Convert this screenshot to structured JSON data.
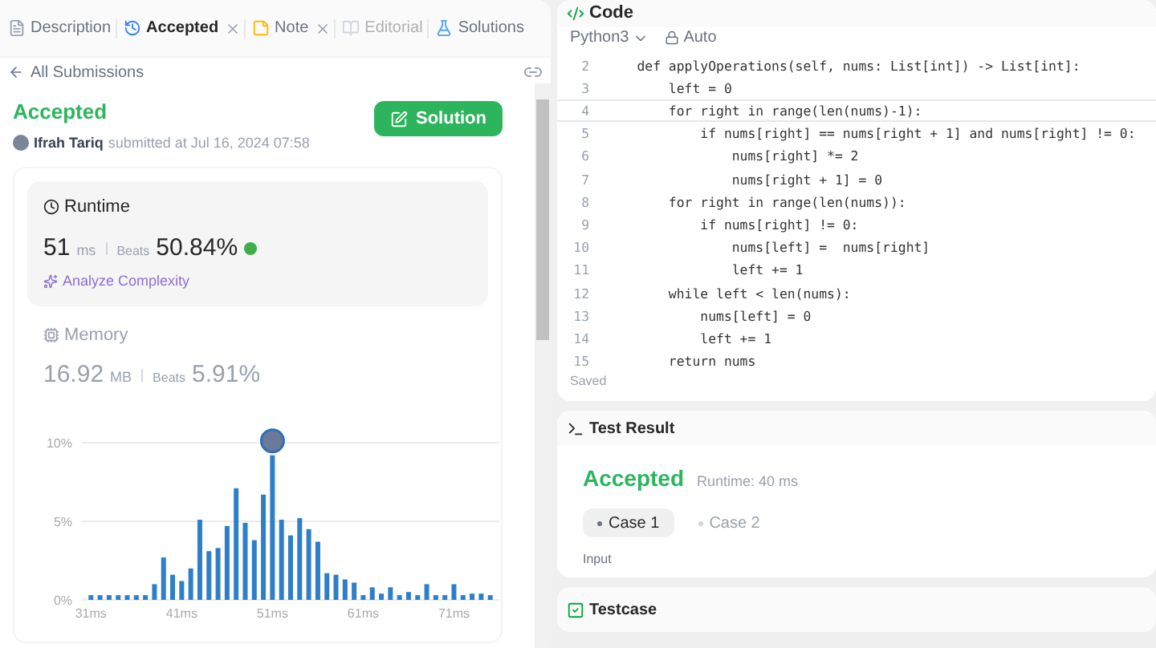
{
  "left_tabs": [
    {
      "label": "Description",
      "selected": false,
      "closable": false,
      "disabled": false,
      "kind": "doc"
    },
    {
      "label": "Accepted",
      "selected": true,
      "closable": true,
      "disabled": false,
      "kind": "history"
    },
    {
      "label": "Note",
      "selected": false,
      "closable": true,
      "disabled": false,
      "kind": "note"
    },
    {
      "label": "Editorial",
      "selected": false,
      "closable": false,
      "disabled": true,
      "kind": "book"
    },
    {
      "label": "Solutions",
      "selected": false,
      "closable": false,
      "disabled": false,
      "kind": "flask"
    }
  ],
  "back_link": "All Submissions",
  "submission": {
    "status": "Accepted",
    "author": "Ifrah Tariq",
    "submitted": "submitted at Jul 16, 2024 07:58",
    "solution_button": "Solution"
  },
  "metrics": [
    {
      "title": "Runtime",
      "value": "51",
      "unit": "ms",
      "beats_label": "Beats",
      "beats": "50.84%",
      "selected": true,
      "analyze": "Analyze Complexity",
      "kind": "clock"
    },
    {
      "title": "Memory",
      "value": "16.92",
      "unit": "MB",
      "beats_label": "Beats",
      "beats": "5.91%",
      "selected": false,
      "kind": "chip"
    }
  ],
  "chart_data": {
    "type": "bar",
    "x": [
      31,
      32,
      33,
      34,
      35,
      36,
      37,
      38,
      39,
      40,
      41,
      42,
      43,
      44,
      45,
      46,
      47,
      48,
      49,
      50,
      51,
      52,
      53,
      54,
      55,
      56,
      57,
      58,
      59,
      60,
      61,
      62,
      63,
      64,
      65,
      66,
      67,
      68,
      69,
      70,
      71,
      72,
      73,
      74,
      75
    ],
    "values": [
      0.3,
      0.3,
      0.3,
      0.3,
      0.3,
      0.3,
      0.3,
      1.0,
      2.7,
      1.6,
      1.2,
      2.0,
      5.1,
      3.1,
      3.3,
      4.7,
      7.1,
      4.9,
      3.8,
      6.7,
      9.2,
      5.1,
      4.1,
      5.2,
      4.5,
      3.7,
      1.7,
      1.6,
      1.3,
      1.1,
      0.3,
      0.8,
      0.4,
      0.8,
      0.3,
      0.5,
      0.3,
      1.0,
      0.3,
      0.3,
      1.0,
      0.3,
      0.4,
      0.4,
      0.3
    ],
    "ylim": [
      0,
      10
    ],
    "yticks": [
      {
        "value": 0,
        "label": "0%"
      },
      {
        "value": 5,
        "label": "5%"
      },
      {
        "value": 10,
        "label": "10%"
      }
    ],
    "xticks": [
      {
        "value": 31,
        "label": "31ms"
      },
      {
        "value": 41,
        "label": "41ms"
      },
      {
        "value": 51,
        "label": "51ms"
      },
      {
        "value": 61,
        "label": "61ms"
      },
      {
        "value": 71,
        "label": "71ms"
      }
    ],
    "xlim": [
      30,
      76
    ]
  },
  "code_panel": {
    "title": "Code",
    "language": "Python3",
    "mode": "Auto",
    "status": "Saved",
    "lines": [
      {
        "number": "2",
        "text": "    def applyOperations(self, nums: List[int]) -> List[int]:",
        "selected": false
      },
      {
        "number": "3",
        "text": "        left = 0",
        "selected": false
      },
      {
        "number": "4",
        "text": "        for right in range(len(nums)-1):",
        "selected": true
      },
      {
        "number": "5",
        "text": "            if nums[right] == nums[right + 1] and nums[right] != 0:",
        "selected": false
      },
      {
        "number": "6",
        "text": "                nums[right] *= 2",
        "selected": false
      },
      {
        "number": "7",
        "text": "                nums[right + 1] = 0",
        "selected": false
      },
      {
        "number": "8",
        "text": "        for right in range(len(nums)):",
        "selected": false
      },
      {
        "number": "9",
        "text": "            if nums[right] != 0:",
        "selected": false
      },
      {
        "number": "10",
        "text": "                nums[left] =  nums[right]",
        "selected": false
      },
      {
        "number": "11",
        "text": "                left += 1",
        "selected": false
      },
      {
        "number": "12",
        "text": "        while left < len(nums):",
        "selected": false
      },
      {
        "number": "13",
        "text": "            nums[left] = 0",
        "selected": false
      },
      {
        "number": "14",
        "text": "            left += 1",
        "selected": false
      },
      {
        "number": "15",
        "text": "        return nums",
        "selected": false
      }
    ]
  },
  "test_result": {
    "title": "Test Result",
    "status": "Accepted",
    "runtime": "Runtime: 40 ms",
    "cases": [
      {
        "label": "Case 1",
        "selected": true
      },
      {
        "label": "Case 2",
        "selected": false
      }
    ],
    "input_label": "Input"
  },
  "testcase_panel": {
    "title": "Testcase"
  }
}
